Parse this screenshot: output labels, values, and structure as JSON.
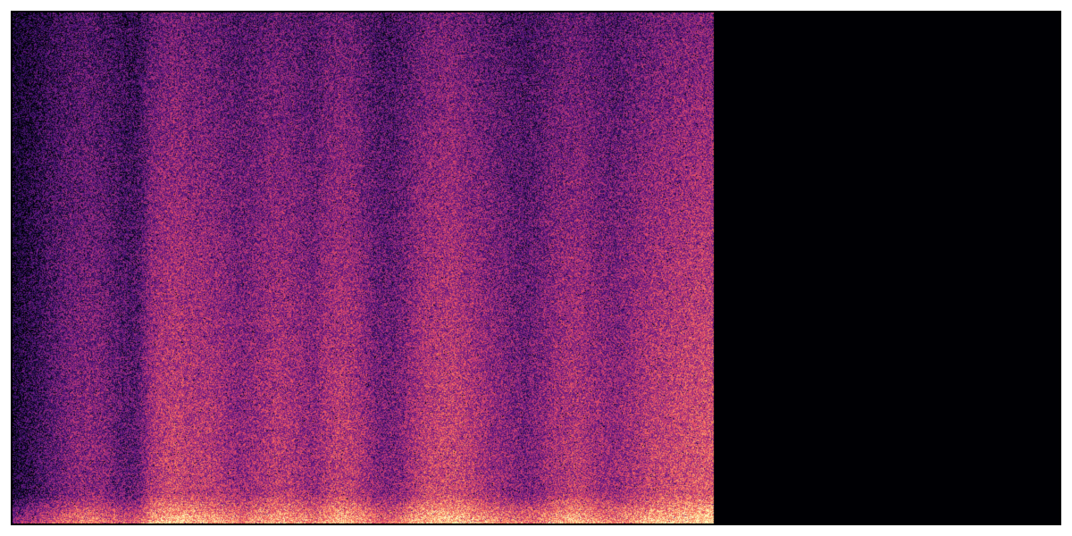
{
  "chart_data": {
    "type": "heatmap",
    "title": "",
    "xlabel": "",
    "ylabel": "",
    "axes_visible": false,
    "grid": false,
    "legend": "none",
    "colormap": "magma",
    "colormap_stops": [
      "#000004",
      "#1c1044",
      "#4f127b",
      "#812581",
      "#b5367a",
      "#e55064",
      "#fb8761",
      "#fec287",
      "#fcfdbf"
    ],
    "background_color": "#000004",
    "frame_color": "#000000",
    "filled_time_fraction": 0.67,
    "time_columns": 56,
    "column_mean_energy": [
      0.08,
      0.16,
      0.22,
      0.3,
      0.36,
      0.4,
      0.42,
      0.4,
      0.35,
      0.3,
      0.32,
      0.5,
      0.56,
      0.58,
      0.55,
      0.54,
      0.52,
      0.48,
      0.44,
      0.46,
      0.5,
      0.54,
      0.52,
      0.48,
      0.44,
      0.52,
      0.56,
      0.54,
      0.48,
      0.4,
      0.38,
      0.42,
      0.5,
      0.56,
      0.58,
      0.6,
      0.56,
      0.52,
      0.48,
      0.44,
      0.4,
      0.38,
      0.42,
      0.48,
      0.52,
      0.54,
      0.5,
      0.46,
      0.44,
      0.48,
      0.52,
      0.56,
      0.58,
      0.6,
      0.62,
      0.64
    ],
    "frequency_rolloff": {
      "low_band_boost": 0.55,
      "low_band_fraction": 0.06,
      "decay_exponent": 0.9
    },
    "noise_level": 0.22,
    "seed": 7
  }
}
